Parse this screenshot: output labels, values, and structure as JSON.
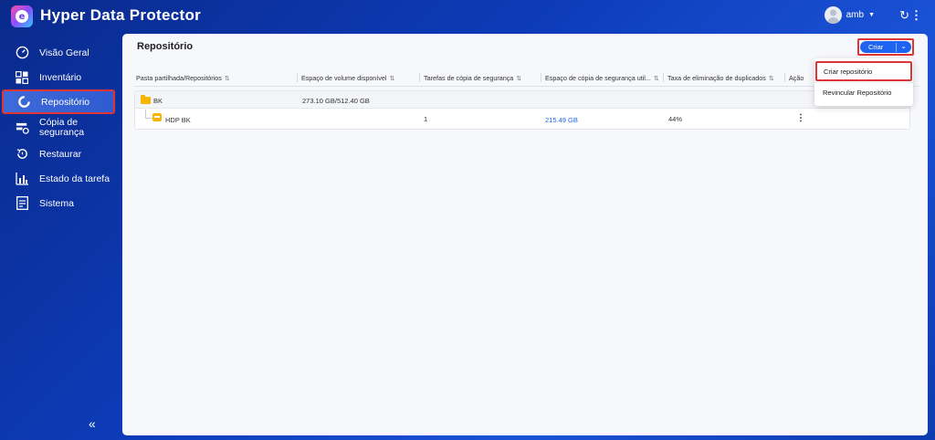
{
  "app": {
    "title": "Hyper Data Protector",
    "logo_letter": "e"
  },
  "header": {
    "user_name": "amb"
  },
  "sidebar": {
    "items": [
      {
        "label": "Visão Geral",
        "icon": "gauge-icon"
      },
      {
        "label": "Inventário",
        "icon": "grid-icon"
      },
      {
        "label": "Repositório",
        "icon": "repository-ring-icon",
        "active": true
      },
      {
        "label": "Cópia de segurança",
        "icon": "backup-icon"
      },
      {
        "label": "Restaurar",
        "icon": "restore-icon"
      },
      {
        "label": "Estado da tarefa",
        "icon": "bar-chart-icon"
      },
      {
        "label": "Sistema",
        "icon": "document-icon"
      }
    ]
  },
  "main": {
    "title": "Repositório",
    "create_button": "Criar",
    "columns": [
      "Pasta partilhada/Repositórios",
      "Espaço de volume disponível",
      "Tarefas de cópia de segurança",
      "Espaço de cópia de segurança util...",
      "Taxa de eliminação de duplicados",
      "Ação"
    ],
    "folder": {
      "name": "BK",
      "volume_space": "273.10 GB/512.40 GB"
    },
    "repository": {
      "name": "HDP BK",
      "backup_tasks": "1",
      "backup_space": "215.49 GB",
      "dedup_rate": "44%"
    },
    "dropdown": {
      "items": [
        "Criar repositório",
        "Revincular Repositório"
      ]
    }
  },
  "colors": {
    "accent": "#1f64f0",
    "highlight": "#e03535",
    "folder": "#f7b500"
  }
}
